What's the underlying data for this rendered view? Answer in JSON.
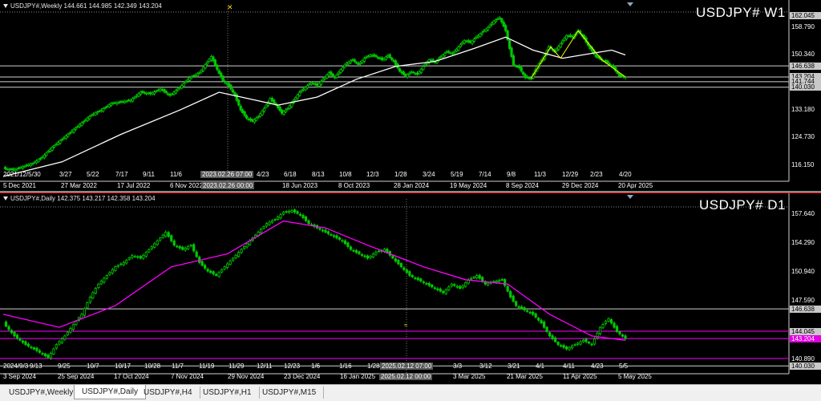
{
  "weekly": {
    "info": "USDJPY#,Weekly  144.661 144.985 142.349 143.204",
    "label": "USDJPY# W1",
    "prices": [
      "162.045",
      "158.790",
      "150.340",
      "146.638",
      "143.204",
      "141.744",
      "140.030",
      "133.180",
      "124.730",
      "116.150"
    ],
    "xlabels": [
      "5 Dec 2021",
      "27 Mar 2022",
      "17 Jul 2022",
      "6 Nov 2022",
      "2023.02.26 00:00",
      "18 Jun 2023",
      "8 Oct 2023",
      "28 Jan 2024",
      "19 May 2024",
      "8 Sep 2024",
      "29 Dec 2024",
      "20 Apr 2025"
    ],
    "minilabels": [
      "2021/12/5/30",
      "3/27",
      "5/22",
      "7/17",
      "9/11",
      "11/6",
      "2023.02.26 07:00",
      "4/23",
      "6/18",
      "8/13",
      "10/8",
      "12/3",
      "1/28",
      "3/24",
      "5/19",
      "7/14",
      "9/8",
      "11/3",
      "12/29",
      "2/23",
      "4/20"
    ]
  },
  "daily": {
    "info": "USDJPY#,Daily  142.375 143.217 142.358 143.204",
    "label": "USDJPY# D1",
    "prices": [
      "157.640",
      "154.290",
      "150.940",
      "147.590",
      "146.638",
      "144.045",
      "143.204",
      "140.890",
      "140.030"
    ],
    "xlabels": [
      "3 Sep 2024",
      "25 Sep 2024",
      "17 Oct 2024",
      "7 Nov 2024",
      "29 Nov 2024",
      "23 Dec 2024",
      "16 Jan 2025",
      "2025.02.12 00:00",
      "3 Mar 2025",
      "21 Mar 2025",
      "11 Apr 2025",
      "5 May 2025"
    ],
    "minilabels": [
      "2024/9/3",
      "9/13",
      "9/25",
      "10/7",
      "10/17",
      "10/28",
      "11/7",
      "11/19",
      "11/29",
      "12/11",
      "12/23",
      "1/6",
      "1/16",
      "1/28",
      "2025.02.12 07:00",
      "3/3",
      "3/12",
      "3/21",
      "4/1",
      "4/11",
      "4/23",
      "5/5"
    ]
  },
  "tabs": [
    "USDJPY#,Weekly",
    "USDJPY#,Daily",
    "USDJPY#,H4",
    "USDJPY#,H1",
    "USDJPY#,M15"
  ],
  "active_tab": 1,
  "colors": {
    "candle": "#00c800",
    "ma_weekly": "#ffffff",
    "ma_daily": "#ff00ff",
    "hline": "#c0c0c0",
    "pink": "#ff00ff",
    "yellow_lines": "#ffff00",
    "price_tag": "#c8c8c8"
  },
  "chart_data": [
    {
      "type": "candlestick",
      "title": "USDJPY#,Weekly",
      "ylim": [
        112.0,
        163.5
      ],
      "x_dates": [
        "5 Dec 2021",
        "27 Mar 2022",
        "17 Jul 2022",
        "6 Nov 2022",
        "2023.02.26 00:00",
        "18 Jun 2023",
        "8 Oct 2023",
        "28 Jan 2024",
        "19 May 2024",
        "8 Sep 2024",
        "29 Dec 2024",
        "20 Apr 2025"
      ],
      "close_path": [
        [
          0,
          115.0
        ],
        [
          5,
          114.5
        ],
        [
          10,
          115.5
        ],
        [
          15,
          116.5
        ],
        [
          20,
          118.5
        ],
        [
          25,
          121.5
        ],
        [
          30,
          124.0
        ],
        [
          35,
          126.5
        ],
        [
          40,
          129.0
        ],
        [
          45,
          131.5
        ],
        [
          50,
          133.0
        ],
        [
          55,
          135.0
        ],
        [
          60,
          135.5
        ],
        [
          65,
          136.0
        ],
        [
          70,
          138.5
        ],
        [
          75,
          138.0
        ],
        [
          80,
          139.5
        ],
        [
          85,
          137.5
        ],
        [
          90,
          140.0
        ],
        [
          95,
          143.0
        ],
        [
          100,
          144.5
        ],
        [
          103,
          147.0
        ],
        [
          106,
          149.5
        ],
        [
          109,
          145.5
        ],
        [
          112,
          142.0
        ],
        [
          115,
          140.5
        ],
        [
          118,
          137.5
        ],
        [
          121,
          133.0
        ],
        [
          124,
          130.5
        ],
        [
          127,
          129.5
        ],
        [
          130,
          131.0
        ],
        [
          133,
          133.5
        ],
        [
          136,
          136.5
        ],
        [
          139,
          134.5
        ],
        [
          142,
          132.0
        ],
        [
          145,
          133.5
        ],
        [
          148,
          136.0
        ],
        [
          151,
          138.5
        ],
        [
          154,
          140.0
        ],
        [
          157,
          141.5
        ],
        [
          160,
          140.5
        ],
        [
          163,
          142.5
        ],
        [
          166,
          144.5
        ],
        [
          169,
          143.0
        ],
        [
          172,
          145.5
        ],
        [
          175,
          147.5
        ],
        [
          178,
          148.5
        ],
        [
          181,
          147.0
        ],
        [
          184,
          149.0
        ],
        [
          187,
          150.0
        ],
        [
          190,
          149.5
        ],
        [
          193,
          148.5
        ],
        [
          196,
          149.8
        ],
        [
          199,
          148.0
        ],
        [
          202,
          145.0
        ],
        [
          205,
          143.5
        ],
        [
          208,
          144.8
        ],
        [
          211,
          144.0
        ],
        [
          214,
          146.5
        ],
        [
          217,
          148.5
        ],
        [
          220,
          147.8
        ],
        [
          223,
          149.5
        ],
        [
          226,
          151.0
        ],
        [
          229,
          150.5
        ],
        [
          232,
          152.5
        ],
        [
          235,
          154.5
        ],
        [
          238,
          153.8
        ],
        [
          241,
          155.5
        ],
        [
          244,
          157.0
        ],
        [
          247,
          158.5
        ],
        [
          250,
          160.5
        ],
        [
          253,
          161.5
        ],
        [
          256,
          157.5
        ],
        [
          258,
          152.0
        ],
        [
          260,
          147.0
        ],
        [
          263,
          146.0
        ],
        [
          266,
          143.0
        ],
        [
          269,
          142.8
        ],
        [
          272,
          146.5
        ],
        [
          275,
          149.0
        ],
        [
          278,
          152.5
        ],
        [
          281,
          151.0
        ],
        [
          284,
          153.5
        ],
        [
          287,
          156.0
        ],
        [
          290,
          155.5
        ],
        [
          293,
          157.5
        ],
        [
          296,
          155.0
        ],
        [
          299,
          152.0
        ],
        [
          302,
          149.5
        ],
        [
          305,
          148.5
        ],
        [
          308,
          147.5
        ],
        [
          311,
          146.0
        ],
        [
          314,
          143.5
        ],
        [
          317,
          143.2
        ]
      ],
      "ma_path": [
        [
          0,
          112.5
        ],
        [
          30,
          117.0
        ],
        [
          60,
          125.5
        ],
        [
          90,
          133.0
        ],
        [
          110,
          138.5
        ],
        [
          125,
          136.5
        ],
        [
          140,
          134.5
        ],
        [
          160,
          137.0
        ],
        [
          180,
          142.5
        ],
        [
          200,
          146.5
        ],
        [
          220,
          148.0
        ],
        [
          240,
          152.0
        ],
        [
          256,
          155.5
        ],
        [
          270,
          151.5
        ],
        [
          285,
          149.0
        ],
        [
          300,
          150.5
        ],
        [
          310,
          151.5
        ],
        [
          317,
          150.0
        ]
      ],
      "hlines": [
        146.638,
        143.204,
        141.744,
        140.03
      ],
      "current_price": 143.204
    },
    {
      "type": "candlestick",
      "title": "USDJPY#,Daily",
      "ylim": [
        139.5,
        158.8
      ],
      "x_dates": [
        "3 Sep 2024",
        "25 Sep 2024",
        "17 Oct 2024",
        "7 Nov 2024",
        "29 Nov 2024",
        "23 Dec 2024",
        "16 Jan 2025",
        "2025.02.12 00:00",
        "3 Mar 2025",
        "21 Mar 2025",
        "11 Apr 2025",
        "5 May 2025"
      ],
      "close_path": [
        [
          0,
          145.0
        ],
        [
          4,
          143.5
        ],
        [
          8,
          142.5
        ],
        [
          12,
          141.8
        ],
        [
          16,
          141.0
        ],
        [
          19,
          142.5
        ],
        [
          22,
          143.5
        ],
        [
          25,
          144.8
        ],
        [
          28,
          146.0
        ],
        [
          31,
          148.0
        ],
        [
          34,
          149.5
        ],
        [
          37,
          150.5
        ],
        [
          40,
          151.5
        ],
        [
          43,
          152.0
        ],
        [
          46,
          152.8
        ],
        [
          49,
          152.5
        ],
        [
          52,
          153.5
        ],
        [
          55,
          154.5
        ],
        [
          58,
          155.5
        ],
        [
          61,
          154.0
        ],
        [
          64,
          153.5
        ],
        [
          67,
          154.0
        ],
        [
          70,
          152.0
        ],
        [
          73,
          151.0
        ],
        [
          76,
          150.5
        ],
        [
          79,
          151.5
        ],
        [
          82,
          152.5
        ],
        [
          85,
          153.5
        ],
        [
          88,
          154.5
        ],
        [
          91,
          155.5
        ],
        [
          94,
          156.5
        ],
        [
          97,
          157.0
        ],
        [
          100,
          157.8
        ],
        [
          103,
          158.0
        ],
        [
          106,
          157.5
        ],
        [
          109,
          156.5
        ],
        [
          112,
          156.0
        ],
        [
          115,
          155.5
        ],
        [
          118,
          155.0
        ],
        [
          121,
          154.5
        ],
        [
          124,
          153.5
        ],
        [
          127,
          153.0
        ],
        [
          130,
          152.5
        ],
        [
          133,
          153.2
        ],
        [
          136,
          153.5
        ],
        [
          139,
          152.5
        ],
        [
          142,
          151.5
        ],
        [
          145,
          150.5
        ],
        [
          148,
          150.0
        ],
        [
          151,
          149.5
        ],
        [
          154,
          149.0
        ],
        [
          157,
          148.5
        ],
        [
          160,
          149.5
        ],
        [
          163,
          149.0
        ],
        [
          166,
          150.0
        ],
        [
          169,
          150.5
        ],
        [
          172,
          149.5
        ],
        [
          175,
          149.8
        ],
        [
          178,
          150.0
        ],
        [
          181,
          148.0
        ],
        [
          183,
          147.0
        ],
        [
          186,
          146.5
        ],
        [
          189,
          146.0
        ],
        [
          192,
          145.0
        ],
        [
          195,
          143.5
        ],
        [
          198,
          142.5
        ],
        [
          201,
          142.0
        ],
        [
          204,
          142.5
        ],
        [
          207,
          143.0
        ],
        [
          210,
          142.5
        ],
        [
          213,
          144.5
        ],
        [
          216,
          145.5
        ],
        [
          219,
          144.0
        ],
        [
          222,
          143.2
        ]
      ],
      "ma_path": [
        [
          0,
          146.0
        ],
        [
          20,
          144.5
        ],
        [
          40,
          147.0
        ],
        [
          60,
          151.5
        ],
        [
          80,
          153.0
        ],
        [
          100,
          156.8
        ],
        [
          115,
          156.0
        ],
        [
          130,
          154.0
        ],
        [
          150,
          151.5
        ],
        [
          165,
          150.0
        ],
        [
          180,
          149.5
        ],
        [
          195,
          146.0
        ],
        [
          210,
          143.5
        ],
        [
          222,
          143.0
        ]
      ],
      "hlines": [
        146.638,
        144.045,
        143.204,
        140.89,
        140.03
      ],
      "current_price": 143.204
    }
  ]
}
